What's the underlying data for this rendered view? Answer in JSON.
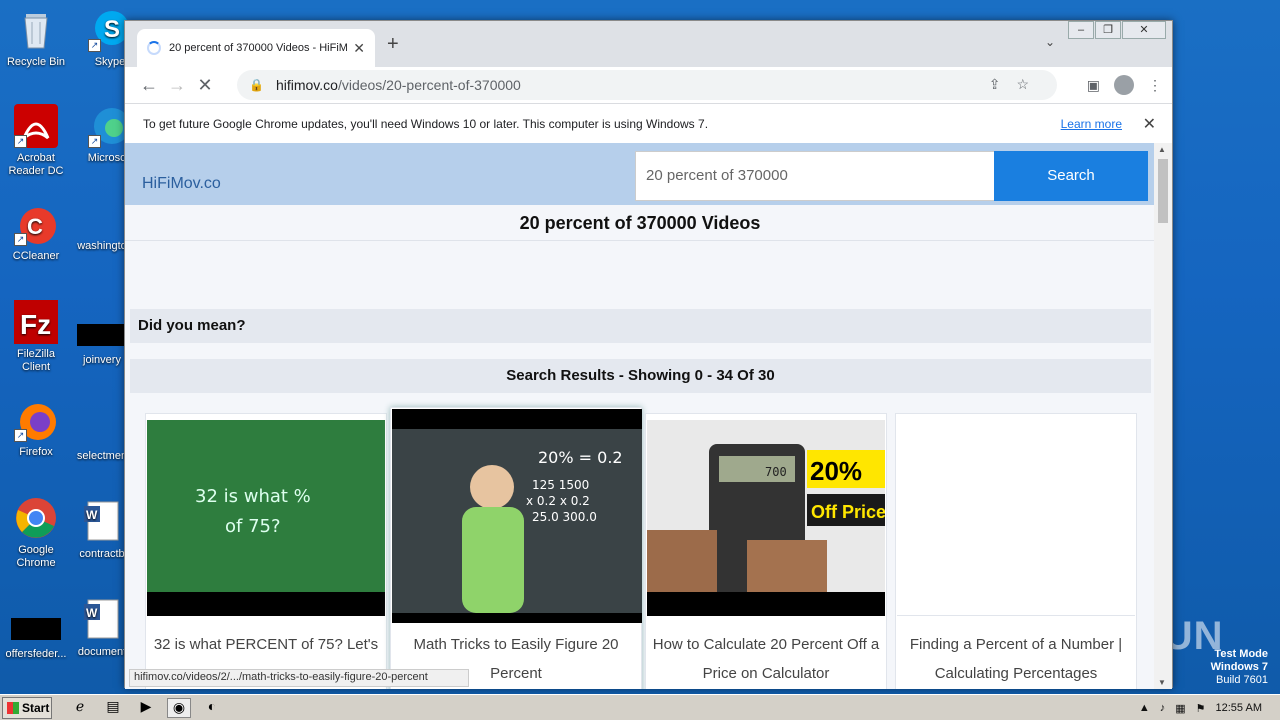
{
  "desktop": {
    "icons": [
      {
        "label": "Recycle Bin",
        "icon": "recycle-bin-icon"
      },
      {
        "label": "Skype",
        "icon": "skype-icon"
      },
      {
        "label": "Acrobat Reader DC",
        "icon": "acrobat-icon"
      },
      {
        "label": "Microsoft",
        "icon": "edge-icon"
      },
      {
        "label": "CCleaner",
        "icon": "ccleaner-icon"
      },
      {
        "label": "washingto",
        "icon": "file-icon"
      },
      {
        "label": "FileZilla Client",
        "icon": "filezilla-icon"
      },
      {
        "label": "joinvery",
        "icon": "file-icon"
      },
      {
        "label": "Firefox",
        "icon": "firefox-icon"
      },
      {
        "label": "selectmen",
        "icon": "file-icon"
      },
      {
        "label": "Google Chrome",
        "icon": "chrome-icon"
      },
      {
        "label": "contractb",
        "icon": "word-icon"
      },
      {
        "label": "offersfeder...",
        "icon": "file-icon"
      },
      {
        "label": "document",
        "icon": "word-icon"
      }
    ]
  },
  "browser": {
    "tab_title": "20 percent of 370000 Videos - HiFiM",
    "url_host": "hifimov.co",
    "url_path": "/videos/20-percent-of-370000",
    "infobar_text": "To get future Google Chrome updates, you'll need Windows 10 or later. This computer is using Windows 7.",
    "infobar_link": "Learn more",
    "status_url": "hifimov.co/videos/2/.../math-tricks-to-easily-figure-20-percent"
  },
  "site": {
    "logo": "HiFiMov.co",
    "search_value": "20 percent of 370000",
    "search_button": "Search",
    "page_title": "20 percent of 370000 Videos",
    "did_you_mean": "Did you mean?",
    "results_label": "Search Results - Showing 0 - 34 Of 30",
    "videos": [
      {
        "caption": "32 is what PERCENT of 75? Let's"
      },
      {
        "caption": "Math Tricks to Easily Figure 20 Percent"
      },
      {
        "caption": "How to Calculate 20 Percent Off a Price on Calculator"
      },
      {
        "caption": "Finding a Percent of a Number | Calculating Percentages"
      }
    ],
    "thumb1_text1": "32 is what %",
    "thumb1_text2": "of 75?",
    "thumb2_text1": "20% = 0.2",
    "thumb2_text2": "125   1500",
    "thumb2_text3": "x 0.2   x 0.2",
    "thumb2_text4": "25.0   300.0",
    "thumb3_text1": "20%",
    "thumb3_text2": "Off Price",
    "thumb3_display": "700"
  },
  "taskbar": {
    "start_label": "Start",
    "clock": "12:55 AM"
  },
  "watermark": {
    "line1": "Test Mode",
    "line2": "Windows 7",
    "line3": "Build 7601",
    "brand": "ANY RUN"
  }
}
